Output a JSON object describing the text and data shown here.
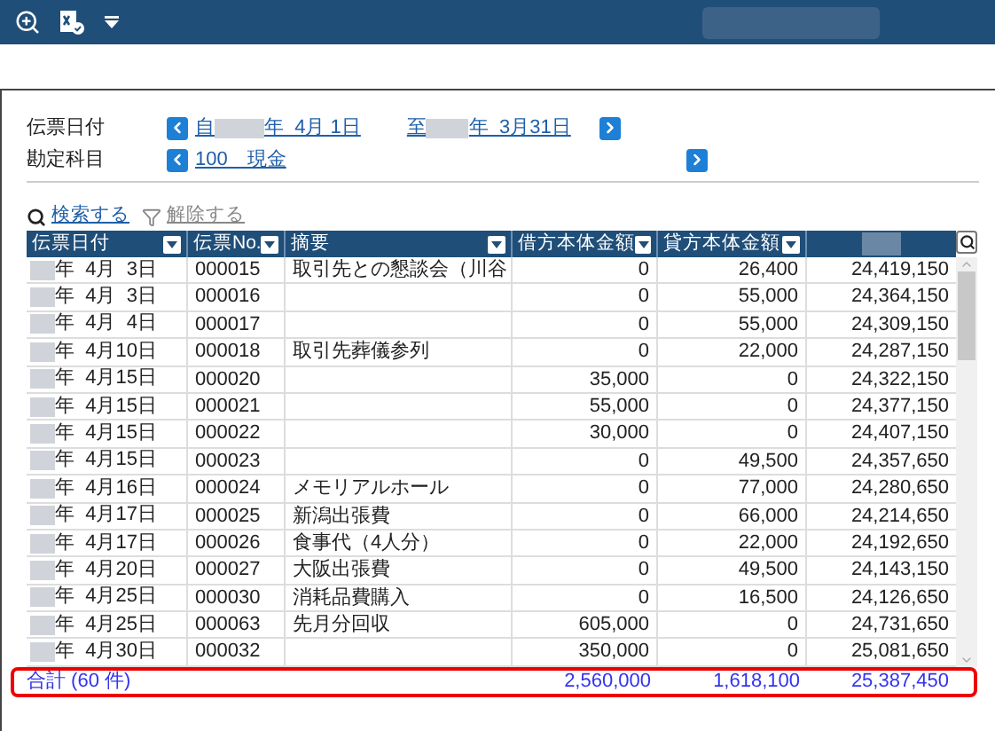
{
  "filters": [
    {
      "label": "伝票日付",
      "kind": "range",
      "from_prefix": "自",
      "from_suffix": "年  4月 1日",
      "to_prefix": "至",
      "to_suffix": "年  3月31日"
    },
    {
      "label": "勘定科目",
      "kind": "account",
      "value": "100　現金"
    }
  ],
  "actions": [
    {
      "label": "検索する",
      "disabled": false
    },
    {
      "label": "解除する",
      "disabled": true
    }
  ],
  "table": {
    "columns": [
      "伝票日付",
      "伝票No.",
      "摘要",
      "借方本体金額",
      "貸方本体金額"
    ],
    "rows": [
      {
        "date": "年  4月  3日",
        "no": "000015",
        "memo": "取引先との懇談会（川谷",
        "debit": "0",
        "credit": "26,400",
        "balance": "24,419,150"
      },
      {
        "date": "年  4月  3日",
        "no": "000016",
        "memo": "",
        "debit": "0",
        "credit": "55,000",
        "balance": "24,364,150"
      },
      {
        "date": "年  4月  4日",
        "no": "000017",
        "memo": "",
        "debit": "0",
        "credit": "55,000",
        "balance": "24,309,150"
      },
      {
        "date": "年  4月10日",
        "no": "000018",
        "memo": "取引先葬儀参列",
        "debit": "0",
        "credit": "22,000",
        "balance": "24,287,150"
      },
      {
        "date": "年  4月15日",
        "no": "000020",
        "memo": "",
        "debit": "35,000",
        "credit": "0",
        "balance": "24,322,150"
      },
      {
        "date": "年  4月15日",
        "no": "000021",
        "memo": "",
        "debit": "55,000",
        "credit": "0",
        "balance": "24,377,150"
      },
      {
        "date": "年  4月15日",
        "no": "000022",
        "memo": "",
        "debit": "30,000",
        "credit": "0",
        "balance": "24,407,150"
      },
      {
        "date": "年  4月15日",
        "no": "000023",
        "memo": "",
        "debit": "0",
        "credit": "49,500",
        "balance": "24,357,650"
      },
      {
        "date": "年  4月16日",
        "no": "000024",
        "memo": "メモリアルホール",
        "debit": "0",
        "credit": "77,000",
        "balance": "24,280,650"
      },
      {
        "date": "年  4月17日",
        "no": "000025",
        "memo": "新潟出張費",
        "debit": "0",
        "credit": "66,000",
        "balance": "24,214,650"
      },
      {
        "date": "年  4月17日",
        "no": "000026",
        "memo": "食事代（4人分）",
        "debit": "0",
        "credit": "22,000",
        "balance": "24,192,650"
      },
      {
        "date": "年  4月20日",
        "no": "000027",
        "memo": "大阪出張費",
        "debit": "0",
        "credit": "49,500",
        "balance": "24,143,150"
      },
      {
        "date": "年  4月25日",
        "no": "000030",
        "memo": "消耗品費購入",
        "debit": "0",
        "credit": "16,500",
        "balance": "24,126,650"
      },
      {
        "date": "年  4月25日",
        "no": "000063",
        "memo": "先月分回収",
        "debit": "605,000",
        "credit": "0",
        "balance": "24,731,650"
      },
      {
        "date": "年  4月30日",
        "no": "000032",
        "memo": "",
        "debit": "350,000",
        "credit": "0",
        "balance": "25,081,650"
      }
    ],
    "total": {
      "label": "合計 (60 件)",
      "debit": "2,560,000",
      "credit": "1,618,100",
      "balance": "25,387,450",
      "highlighted": true
    }
  }
}
